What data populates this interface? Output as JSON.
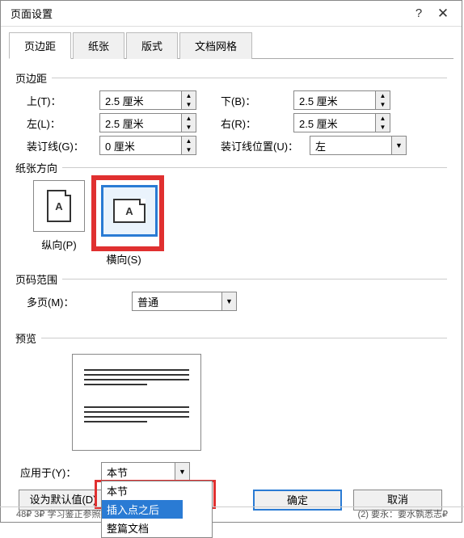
{
  "titlebar": {
    "title": "页面设置"
  },
  "tabs": [
    "页边距",
    "纸张",
    "版式",
    "文档网格"
  ],
  "margins": {
    "section": "页边距",
    "top_label": "上(T)：",
    "top": "2.5 厘米",
    "bottom_label": "下(B)：",
    "bottom": "2.5 厘米",
    "left_label": "左(L)：",
    "left": "2.5 厘米",
    "right_label": "右(R)：",
    "right": "2.5 厘米",
    "gutter_label": "装订线(G)：",
    "gutter": "0 厘米",
    "gutter_pos_label": "装订线位置(U)：",
    "gutter_pos": "左"
  },
  "orientation": {
    "section": "纸张方向",
    "portrait": "纵向(P)",
    "landscape": "横向(S)",
    "glyph": "A"
  },
  "pages": {
    "section": "页码范围",
    "multi_label": "多页(M)：",
    "multi": "普通"
  },
  "preview": {
    "section": "预览"
  },
  "apply": {
    "label": "应用于(Y)：",
    "value": "本节",
    "options": [
      "本节",
      "插入点之后",
      "整篇文档"
    ]
  },
  "footer": {
    "defaults": "设为默认值(D)",
    "ok": "确定",
    "cancel": "取消"
  },
  "background": {
    "left": "48₽       3₽   学习鉴正参照₽",
    "right": "(2) 要永：要水孰悉志₽"
  }
}
